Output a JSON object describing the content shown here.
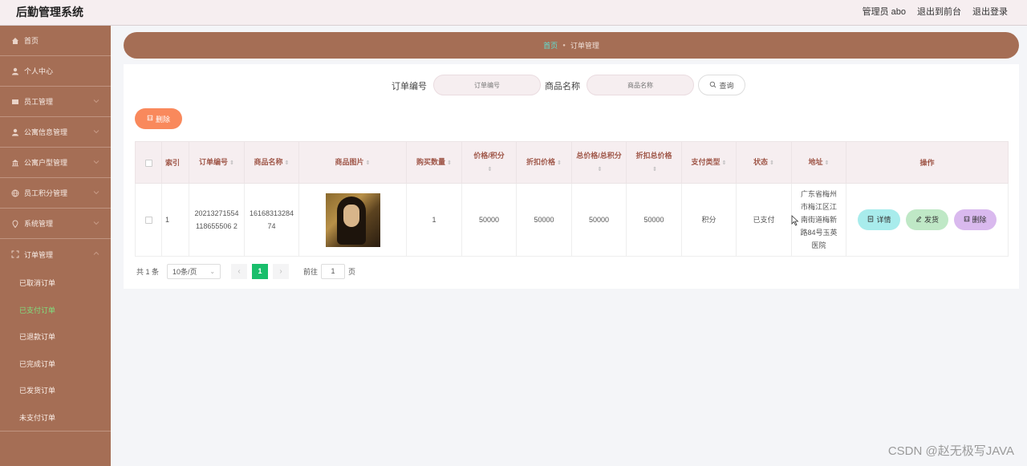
{
  "header": {
    "app_title": "后勤管理系统",
    "admin_label": "管理员 abo",
    "to_front_label": "退出到前台",
    "logout_label": "退出登录"
  },
  "sidebar": {
    "items": [
      {
        "label": "首页",
        "icon": "home-icon"
      },
      {
        "label": "个人中心",
        "icon": "user-icon"
      },
      {
        "label": "员工管理",
        "icon": "message-icon"
      },
      {
        "label": "公寓信息管理",
        "icon": "user-icon"
      },
      {
        "label": "公寓户型管理",
        "icon": "bank-icon"
      },
      {
        "label": "员工积分管理",
        "icon": "globe-icon"
      },
      {
        "label": "系统管理",
        "icon": "location-icon"
      },
      {
        "label": "订单管理",
        "icon": "fullscreen-icon"
      }
    ],
    "order_submenu": [
      {
        "label": "已取消订单",
        "active": false
      },
      {
        "label": "已支付订单",
        "active": true
      },
      {
        "label": "已退款订单",
        "active": false
      },
      {
        "label": "已完成订单",
        "active": false
      },
      {
        "label": "已发货订单",
        "active": false
      },
      {
        "label": "未支付订单",
        "active": false
      }
    ]
  },
  "breadcrumb": {
    "home": "首页",
    "separator": "●",
    "current": "订单管理"
  },
  "search": {
    "order_no_label": "订单编号",
    "order_no_placeholder": "订单编号",
    "product_name_label": "商品名称",
    "product_name_placeholder": "商品名称",
    "search_button": "查询"
  },
  "actions": {
    "delete_button": "删除"
  },
  "table": {
    "columns": {
      "index": "索引",
      "order_no": "订单编号",
      "product_name": "商品名称",
      "product_image": "商品图片",
      "quantity": "购买数量",
      "price_points": "价格/积分",
      "discount_price": "折扣价格",
      "total_price_points": "总价格/总积分",
      "discount_total": "折扣总价格",
      "pay_type": "支付类型",
      "status": "状态",
      "address": "地址",
      "operation": "操作"
    },
    "rows": [
      {
        "index": "1",
        "order_no": "20213271554118655506 2",
        "product_name": "1616831328474",
        "quantity": "1",
        "price_points": "50000",
        "discount_price": "50000",
        "total_price_points": "50000",
        "discount_total": "50000",
        "pay_type": "积分",
        "status": "已支付",
        "address": "广东省梅州市梅江区江南街道梅新路84号玉英医院",
        "detail_button": "详情",
        "ship_button": "发货",
        "delete_button": "删除"
      }
    ]
  },
  "pagination": {
    "total": "共 1 条",
    "page_size": "10条/页",
    "prev": "‹",
    "current_page": "1",
    "next": "›",
    "goto_label": "前往",
    "goto_value": "1",
    "page_suffix": "页"
  },
  "watermark": "CSDN @赵无极写JAVA",
  "colors": {
    "sidebar": "#a56e55",
    "header": "#f6eef0",
    "active_submenu": "#7fe07f",
    "delete_button": "#f9895c",
    "current_page": "#19be6b"
  }
}
